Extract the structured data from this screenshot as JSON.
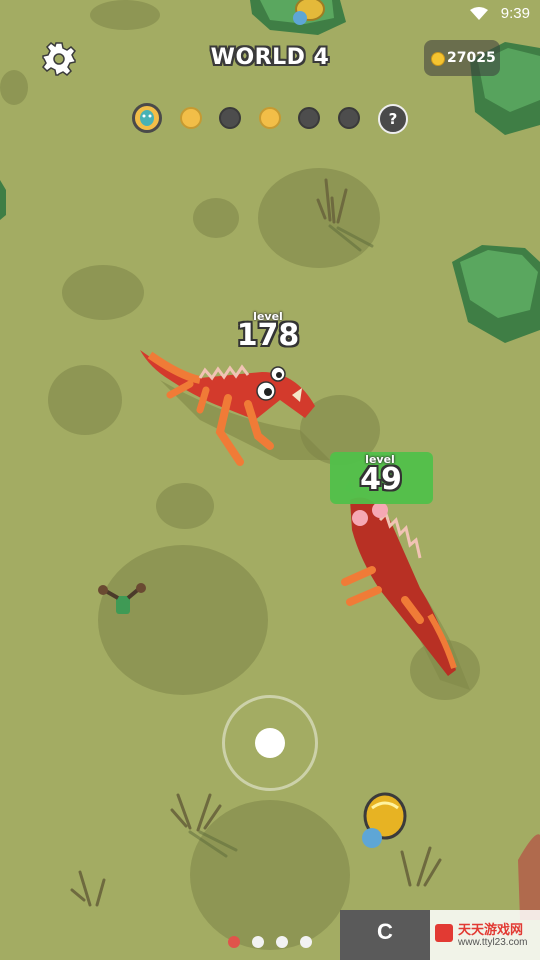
{
  "status_bar": {
    "time": "9:39"
  },
  "header": {
    "world_title": "WORLD 4",
    "coins": "27025"
  },
  "progress": {
    "current_icon": "dino-egg-icon",
    "unknown_label": "?",
    "dots": [
      "current",
      "gold",
      "gray",
      "gold",
      "gray",
      "gray",
      "unknown"
    ]
  },
  "enemy": {
    "level_caption": "level",
    "level": "178"
  },
  "player": {
    "level_caption": "level",
    "level": "49"
  },
  "page_indicator": {
    "count": 4,
    "active_index": 0
  },
  "watermark": {
    "logo_text": "C",
    "site_name": "天天游戏网",
    "url": "www.ttyl23.com"
  },
  "colors": {
    "ground": "#a3ac63",
    "mud": "#8e9654",
    "player_badge": "#51c04a",
    "enemy_dino": "#d33a2c",
    "player_dino": "#b83024",
    "coin": "#f4c430",
    "bush": "#4e9a55"
  }
}
